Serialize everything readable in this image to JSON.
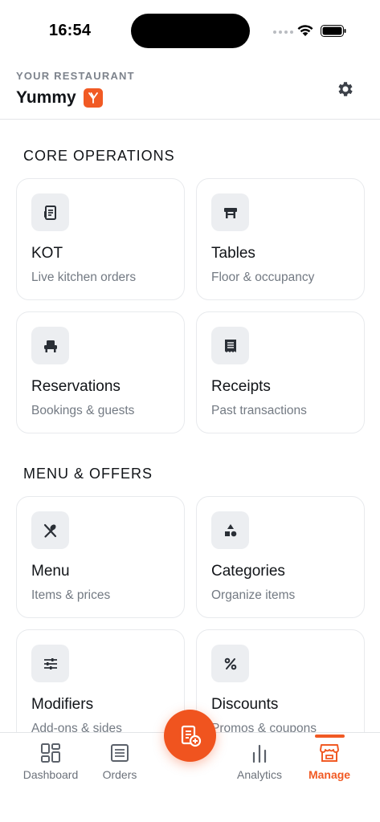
{
  "status_bar": {
    "time": "16:54"
  },
  "header": {
    "caption": "YOUR RESTAURANT",
    "title": "Yummy"
  },
  "sections": [
    {
      "title": "CORE OPERATIONS",
      "cards": [
        {
          "name": "KOT",
          "sub": "Live kitchen orders",
          "icon": "receipt-icon"
        },
        {
          "name": "Tables",
          "sub": "Floor & occupancy",
          "icon": "table-icon"
        },
        {
          "name": "Reservations",
          "sub": "Bookings & guests",
          "icon": "chair-icon"
        },
        {
          "name": "Receipts",
          "sub": "Past transactions",
          "icon": "receipt-long-icon"
        }
      ]
    },
    {
      "title": "MENU & OFFERS",
      "cards": [
        {
          "name": "Menu",
          "sub": "Items & prices",
          "icon": "utensils-icon"
        },
        {
          "name": "Categories",
          "sub": "Organize items",
          "icon": "shapes-icon"
        },
        {
          "name": "Modifiers",
          "sub": "Add-ons & sides",
          "icon": "sliders-icon"
        },
        {
          "name": "Discounts",
          "sub": "Promos & coupons",
          "icon": "percent-icon"
        }
      ]
    }
  ],
  "nav": {
    "items": [
      {
        "label": "Dashboard",
        "icon": "dashboard-icon"
      },
      {
        "label": "Orders",
        "icon": "orders-icon"
      },
      {
        "label": "Analytics",
        "icon": "analytics-icon"
      },
      {
        "label": "Manage",
        "icon": "store-icon",
        "active": true
      }
    ],
    "fab_icon": "new-order-icon"
  },
  "colors": {
    "accent": "#f15a24",
    "icon_bg": "#eceef1",
    "muted_text": "#737a83"
  }
}
